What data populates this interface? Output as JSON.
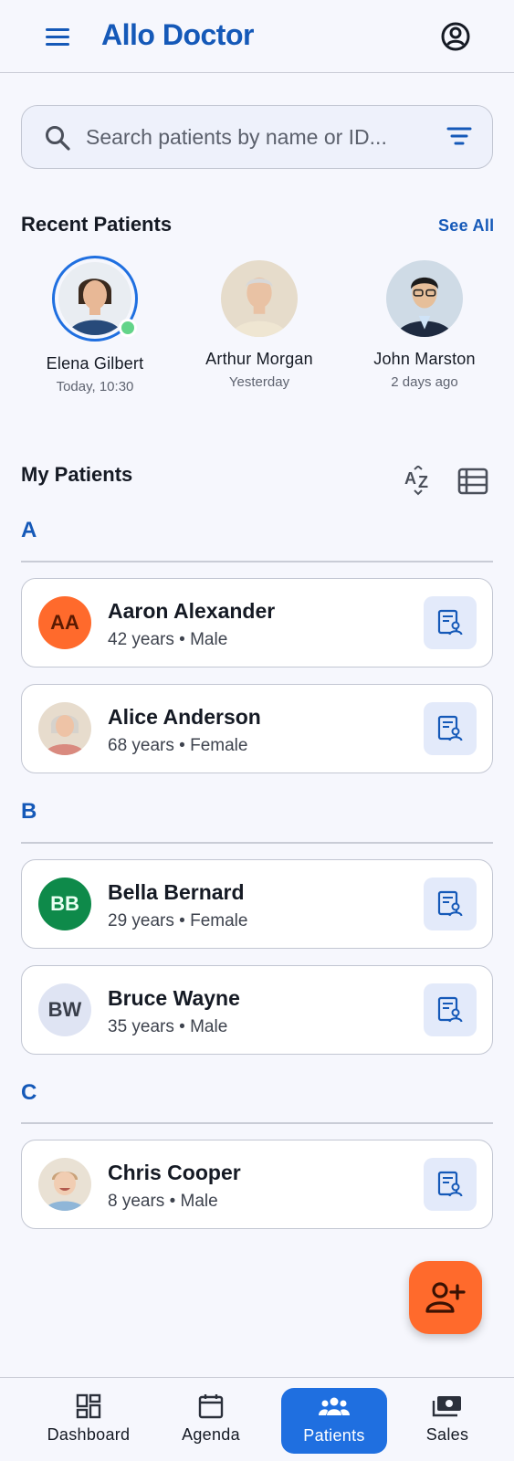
{
  "app": {
    "title": "Allo Doctor",
    "accent_color": "#1559b8",
    "active_color": "#1f6fe0",
    "fab_color": "#ff6a2c"
  },
  "header": {
    "menu_icon": "hamburger-menu-icon",
    "account_icon": "account-circle-icon"
  },
  "search": {
    "placeholder": "Search patients by name or ID...",
    "value": "",
    "icon": "search-icon",
    "filter_icon": "filter-icon"
  },
  "recent": {
    "title": "Recent Patients",
    "see_all": "See All",
    "items": [
      {
        "name": "Elena Gilbert",
        "time": "Today, 10:30",
        "online": true
      },
      {
        "name": "Arthur Morgan",
        "time": "Yesterday",
        "online": false
      },
      {
        "name": "John Marston",
        "time": "2 days ago",
        "online": false
      }
    ]
  },
  "patients": {
    "title": "My Patients",
    "sort_icon": "sort-az-icon",
    "view_icon": "list-view-icon",
    "groups": [
      {
        "letter": "A",
        "items": [
          {
            "initials": "AA",
            "name": "Aaron Alexander",
            "meta": "42 years • Male",
            "avatar_bg": "#ff6a2c",
            "avatar_fg": "#5a1a02"
          },
          {
            "initials": "",
            "name": "Alice Anderson",
            "meta": "68 years • Female",
            "avatar_bg": "",
            "avatar_fg": ""
          }
        ]
      },
      {
        "letter": "B",
        "items": [
          {
            "initials": "BB",
            "name": "Bella Bernard",
            "meta": "29 years • Female",
            "avatar_bg": "#0e8a4a",
            "avatar_fg": "#e9fff2"
          },
          {
            "initials": "BW",
            "name": "Bruce Wayne",
            "meta": "35 years • Male",
            "avatar_bg": "#dfe4f3",
            "avatar_fg": "#3a3f4b"
          }
        ]
      },
      {
        "letter": "C",
        "items": [
          {
            "initials": "",
            "name": "Chris Cooper",
            "meta": "8 years • Male",
            "avatar_bg": "",
            "avatar_fg": ""
          }
        ]
      }
    ],
    "record_icon": "patient-record-icon"
  },
  "fab": {
    "icon": "add-person-icon"
  },
  "nav": {
    "items": [
      {
        "label": "Dashboard",
        "icon": "dashboard-icon",
        "active": false
      },
      {
        "label": "Agenda",
        "icon": "calendar-icon",
        "active": false
      },
      {
        "label": "Patients",
        "icon": "people-icon",
        "active": true
      },
      {
        "label": "Sales",
        "icon": "money-icon",
        "active": false
      }
    ]
  }
}
